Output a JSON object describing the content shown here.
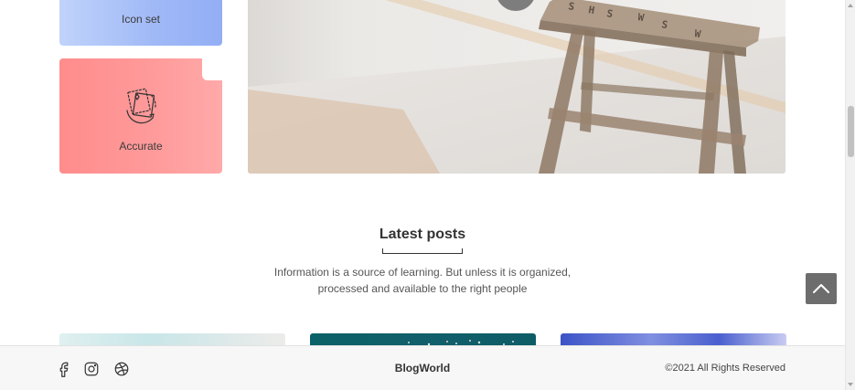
{
  "features": [
    {
      "label": "Icon set",
      "icon": "layers-icon",
      "color": "#9fb8f6"
    },
    {
      "label": "Accurate",
      "icon": "rotate-stack-icon",
      "color": "#ff9b9b"
    }
  ],
  "latest_posts": {
    "title": "Latest posts",
    "description": "Information is a source of learning. But unless it is organized, processed and available to the right people"
  },
  "posts": [
    {
      "thumb": "post-thumbnail-1"
    },
    {
      "thumb": "post-thumbnail-2"
    },
    {
      "thumb": "post-thumbnail-3"
    }
  ],
  "footer": {
    "brand": "BlogWorld",
    "copyright": "©2021 All Rights Reserved",
    "social": [
      "facebook-icon",
      "instagram-icon",
      "dribbble-icon"
    ]
  },
  "back_to_top": {
    "icon": "chevron-up-icon"
  }
}
